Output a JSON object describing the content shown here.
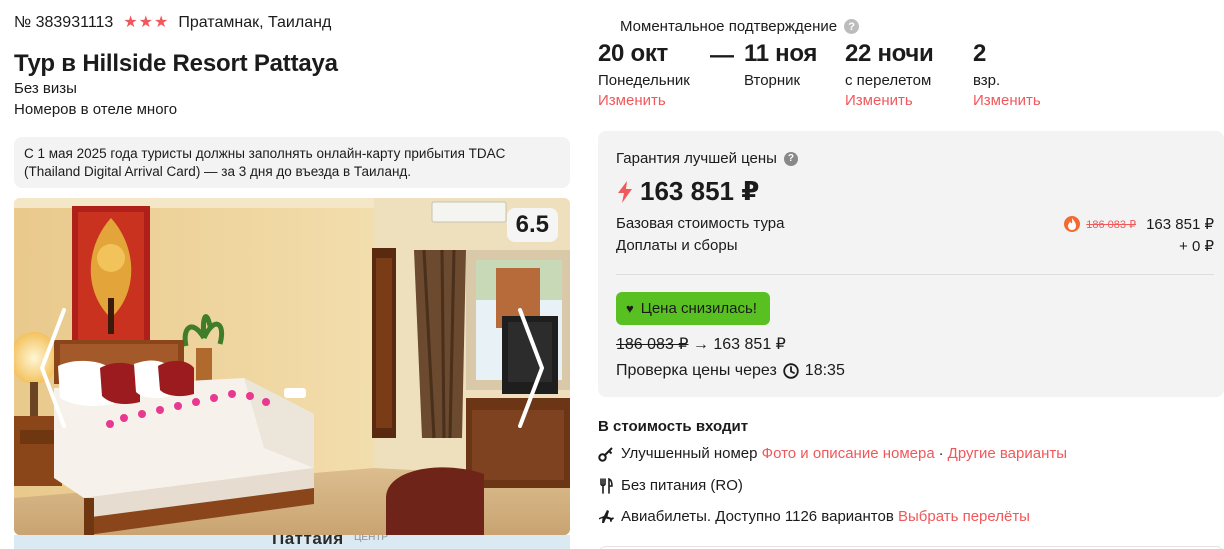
{
  "hotel": {
    "number": "№ 383931113",
    "stars": 3,
    "location": "Пратамнак, Таиланд",
    "title": "Тур в Hillside Resort Pattaya",
    "visa": "Без визы",
    "rooms": "Номеров в отеле много",
    "notice": "С 1 мая 2025 года туристы должны заполнять онлайн-карту прибытия TDAC (Thailand Digital Arrival Card) — за 3 дня до въезда в Таиланд.",
    "rating": "6.5",
    "map_city": "Паттайя",
    "map_centre": "ЦЕНТР"
  },
  "trip": {
    "confirmation": "Моментальное подтверждение",
    "date_from": "20 окт",
    "date_from_day": "Понедельник",
    "dash": "—",
    "date_to": "11 ноя",
    "date_to_day": "Вторник",
    "nights": "22 ночи",
    "nights_note": "с перелетом",
    "guests": "2",
    "guests_note": "взр.",
    "change_label": "Изменить"
  },
  "price": {
    "guarantee": "Гарантия лучшей цены",
    "total": "163 851 ₽",
    "base_label": "Базовая стоимость тура",
    "base_old": "186 083 ₽",
    "base_value": "163 851 ₽",
    "fees_label": "Доплаты и сборы",
    "fees_value": "+ 0 ₽",
    "badge": "Цена снизилась!",
    "change_from": "186 083 ₽",
    "change_arrow": "→",
    "change_to": "163 851 ₽",
    "check_label": "Проверка цены через",
    "check_time": "18:35"
  },
  "includes": {
    "title": "В стоимость входит",
    "room": "Улучшенный номер",
    "room_link1": "Фото и описание номера",
    "room_dot": "·",
    "room_link2": "Другие варианты",
    "meal": "Без питания (RO)",
    "flights": "Авиабилеты. Доступно 1126 вариантов",
    "flights_link": "Выбрать перелёты"
  },
  "colors": {
    "accent": "#f0585b",
    "badge": "#58c021",
    "card": "#f3f3f3"
  }
}
